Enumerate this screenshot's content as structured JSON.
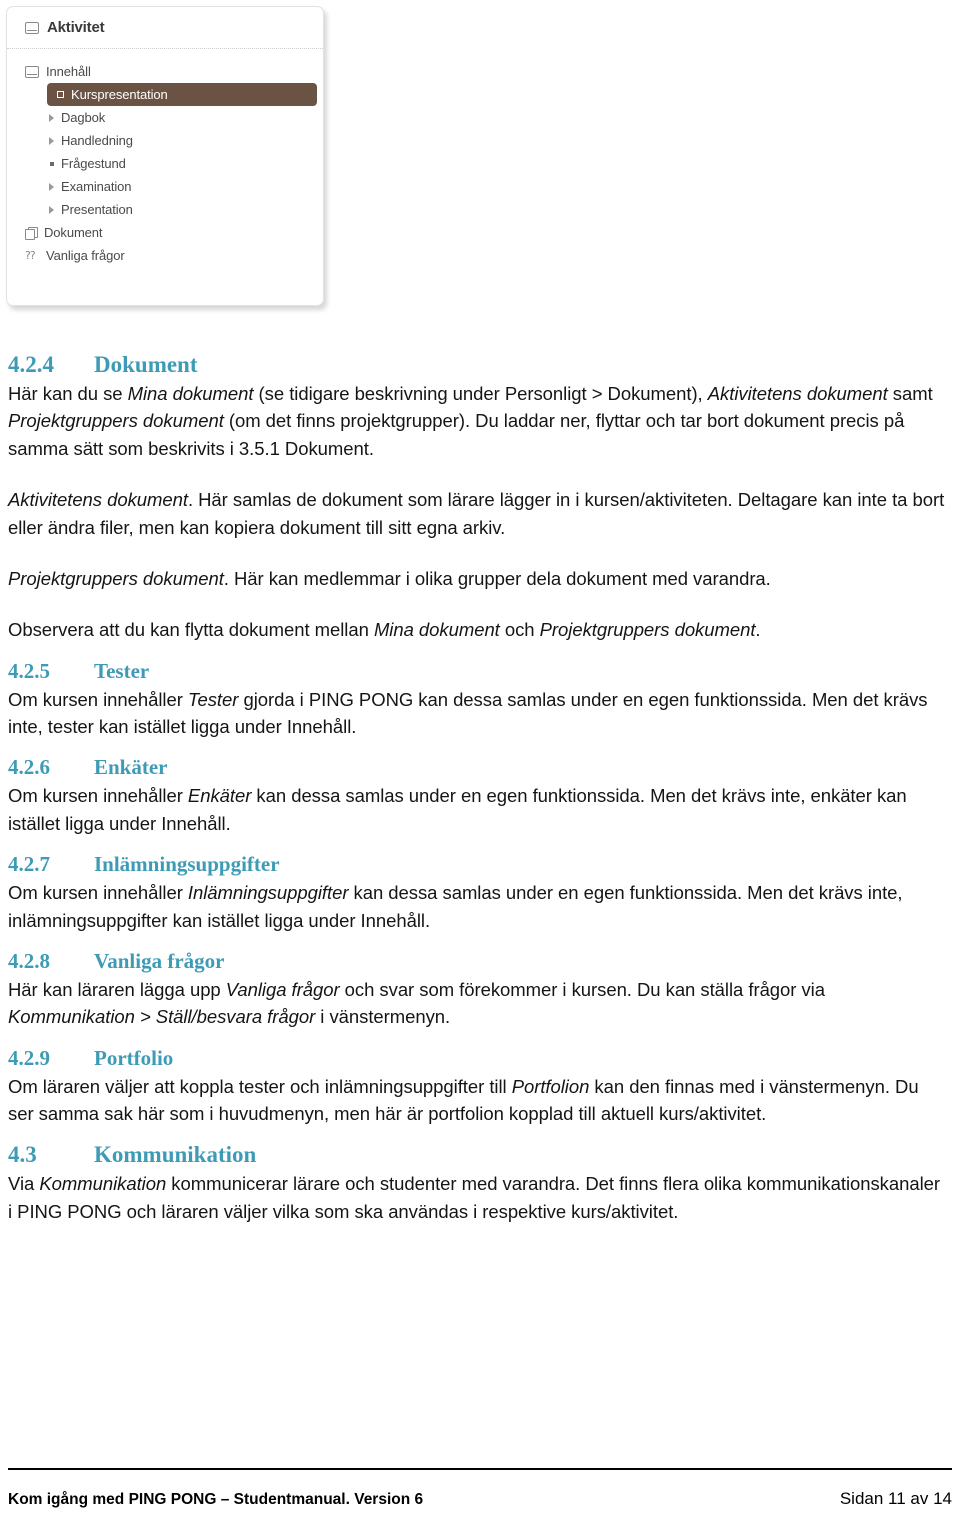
{
  "figure": {
    "panel_title": "Aktivitet",
    "panel_title_icon": "screen-icon",
    "tree": [
      {
        "label": "Innehåll",
        "level": 1,
        "icon": "screen-icon",
        "marker": "none",
        "selected": false
      },
      {
        "label": "Kurspresentation",
        "level": 2,
        "icon": "none",
        "marker": "box",
        "selected": true
      },
      {
        "label": "Dagbok",
        "level": 2,
        "icon": "none",
        "marker": "triangle",
        "selected": false
      },
      {
        "label": "Handledning",
        "level": 2,
        "icon": "none",
        "marker": "triangle",
        "selected": false
      },
      {
        "label": "Frågestund",
        "level": 2,
        "icon": "none",
        "marker": "dot",
        "selected": false
      },
      {
        "label": "Examination",
        "level": 2,
        "icon": "none",
        "marker": "triangle",
        "selected": false
      },
      {
        "label": "Presentation",
        "level": 2,
        "icon": "none",
        "marker": "triangle",
        "selected": false
      },
      {
        "label": "Dokument",
        "level": 1,
        "icon": "pages-icon",
        "marker": "none",
        "selected": false
      },
      {
        "label": "Vanliga frågor",
        "level": 1,
        "icon": "faq-icon",
        "marker": "none",
        "selected": false
      }
    ],
    "selected_bg": "#6b5344",
    "selected_fg": "#ffffff"
  },
  "theme": {
    "heading_color": "#3e9bb6",
    "body_color": "#151515",
    "panel_border": "#e2e2e2"
  },
  "sections": {
    "dokument": {
      "number": "4.2.4",
      "title": "Dokument",
      "p1_a": "Här kan du se ",
      "p1_i1": "Mina dokument",
      "p1_b": " (se tidigare beskrivning under Personligt > Dokument), ",
      "p1_i2": "Aktivitetens dokument",
      "p1_c": " samt ",
      "p1_i3": "Projektgruppers dokument",
      "p1_d": " (om det finns projektgrupper). Du laddar ner, flyttar och tar bort dokument precis på samma sätt som beskrivits i 3.5.1 Dokument.",
      "p2_i": "Aktivitetens dokument",
      "p2_t": ". Här samlas de dokument som lärare lägger in i kursen/aktiviteten. Deltagare kan inte ta bort eller ändra filer, men kan kopiera dokument till sitt egna arkiv.",
      "p3_i": "Projektgruppers dokument",
      "p3_t": ". Här kan medlemmar i olika grupper dela dokument med varandra.",
      "p4_a": "Observera att du kan flytta dokument mellan ",
      "p4_i1": "Mina dokument",
      "p4_b": " och ",
      "p4_i2": "Projektgruppers dokument",
      "p4_c": "."
    },
    "tester": {
      "number": "4.2.5",
      "title": "Tester",
      "p_a": "Om kursen innehåller ",
      "p_i": "Tester",
      "p_b": " gjorda i PING PONG kan dessa samlas under en egen funktionssida. Men det krävs inte, tester kan istället ligga under Innehåll."
    },
    "enkater": {
      "number": "4.2.6",
      "title": "Enkäter",
      "p_a": "Om kursen innehåller ",
      "p_i": "Enkäter",
      "p_b": " kan dessa samlas under en egen funktionssida. Men det krävs inte, enkäter kan istället ligga under Innehåll."
    },
    "inlamningsuppgifter": {
      "number": "4.2.7",
      "title": "Inlämningsuppgifter",
      "p_a": "Om kursen innehåller ",
      "p_i": "Inlämningsuppgifter",
      "p_b": " kan dessa samlas under en egen funktionssida. Men det krävs inte, inlämningsuppgifter kan istället ligga under Innehåll."
    },
    "vanliga_fragor": {
      "number": "4.2.8",
      "title": "Vanliga frågor",
      "p_a": "Här kan läraren lägga upp ",
      "p_i1": "Vanliga frågor",
      "p_b": " och svar som förekommer i kursen. Du kan ställa frågor via ",
      "p_i2": "Kommunikation > Ställ/besvara frågor",
      "p_c": " i vänstermenyn."
    },
    "portfolio": {
      "number": "4.2.9",
      "title": "Portfolio",
      "p_a": "Om läraren väljer att koppla tester och inlämningsuppgifter till ",
      "p_i": "Portfolion",
      "p_b": " kan den finnas med i vänstermenyn. Du ser samma sak här som i huvudmenyn, men här är portfolion kopplad till aktuell kurs/aktivitet."
    },
    "kommunikation": {
      "number": "4.3",
      "title": "Kommunikation",
      "p_a": "Via ",
      "p_i": "Kommunikation",
      "p_b": " kommunicerar lärare och studenter med varandra. Det finns flera olika kommunikationskanaler i PING PONG och läraren väljer vilka som ska användas i respektive kurs/aktivitet."
    }
  },
  "footer": {
    "left": "Kom igång med PING PONG – Studentmanual. Version 6",
    "right": "Sidan 11 av 14"
  }
}
